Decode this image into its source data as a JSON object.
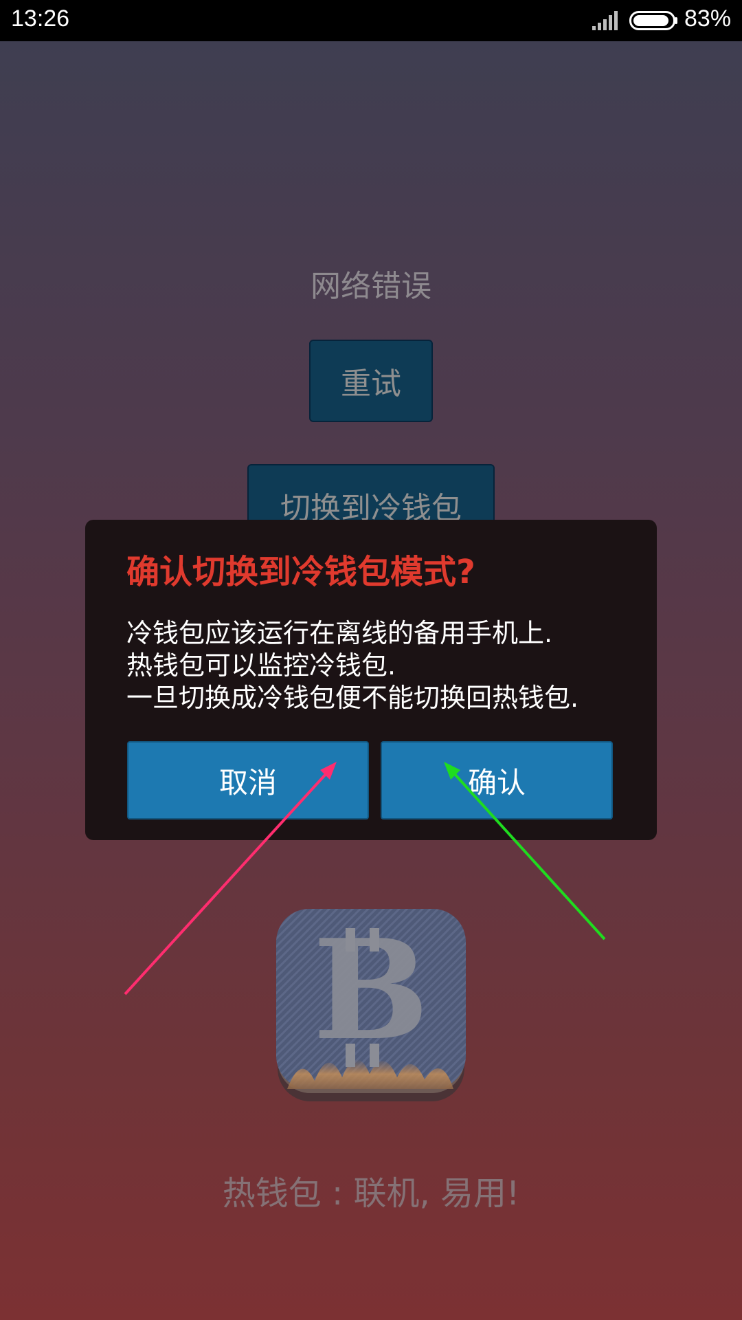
{
  "status_bar": {
    "time": "13:26",
    "battery": "83%",
    "icons": [
      "signal-icon",
      "battery-icon"
    ]
  },
  "background_screen": {
    "error_text": "网络错误",
    "retry_button": "重试",
    "switch_button": "切换到冷钱包",
    "app_icon": "bitcoin-wallet-icon",
    "tagline": "热钱包 : 联机, 易用!"
  },
  "dialog": {
    "title": "确认切换到冷钱包模式?",
    "lines": [
      "冷钱包应该运行在离线的备用手机上.",
      "热钱包可以监控冷钱包.",
      "一旦切换成冷钱包便不能切换回热钱包."
    ],
    "cancel": "取消",
    "confirm": "确认"
  },
  "annotations": {
    "arrow_colors": [
      "#ff2d6f",
      "#1fdc1f"
    ]
  },
  "colors": {
    "dialog_title": "#e03a2e",
    "dialog_button": "#1d79b1",
    "background_button": "#0e3b55"
  }
}
